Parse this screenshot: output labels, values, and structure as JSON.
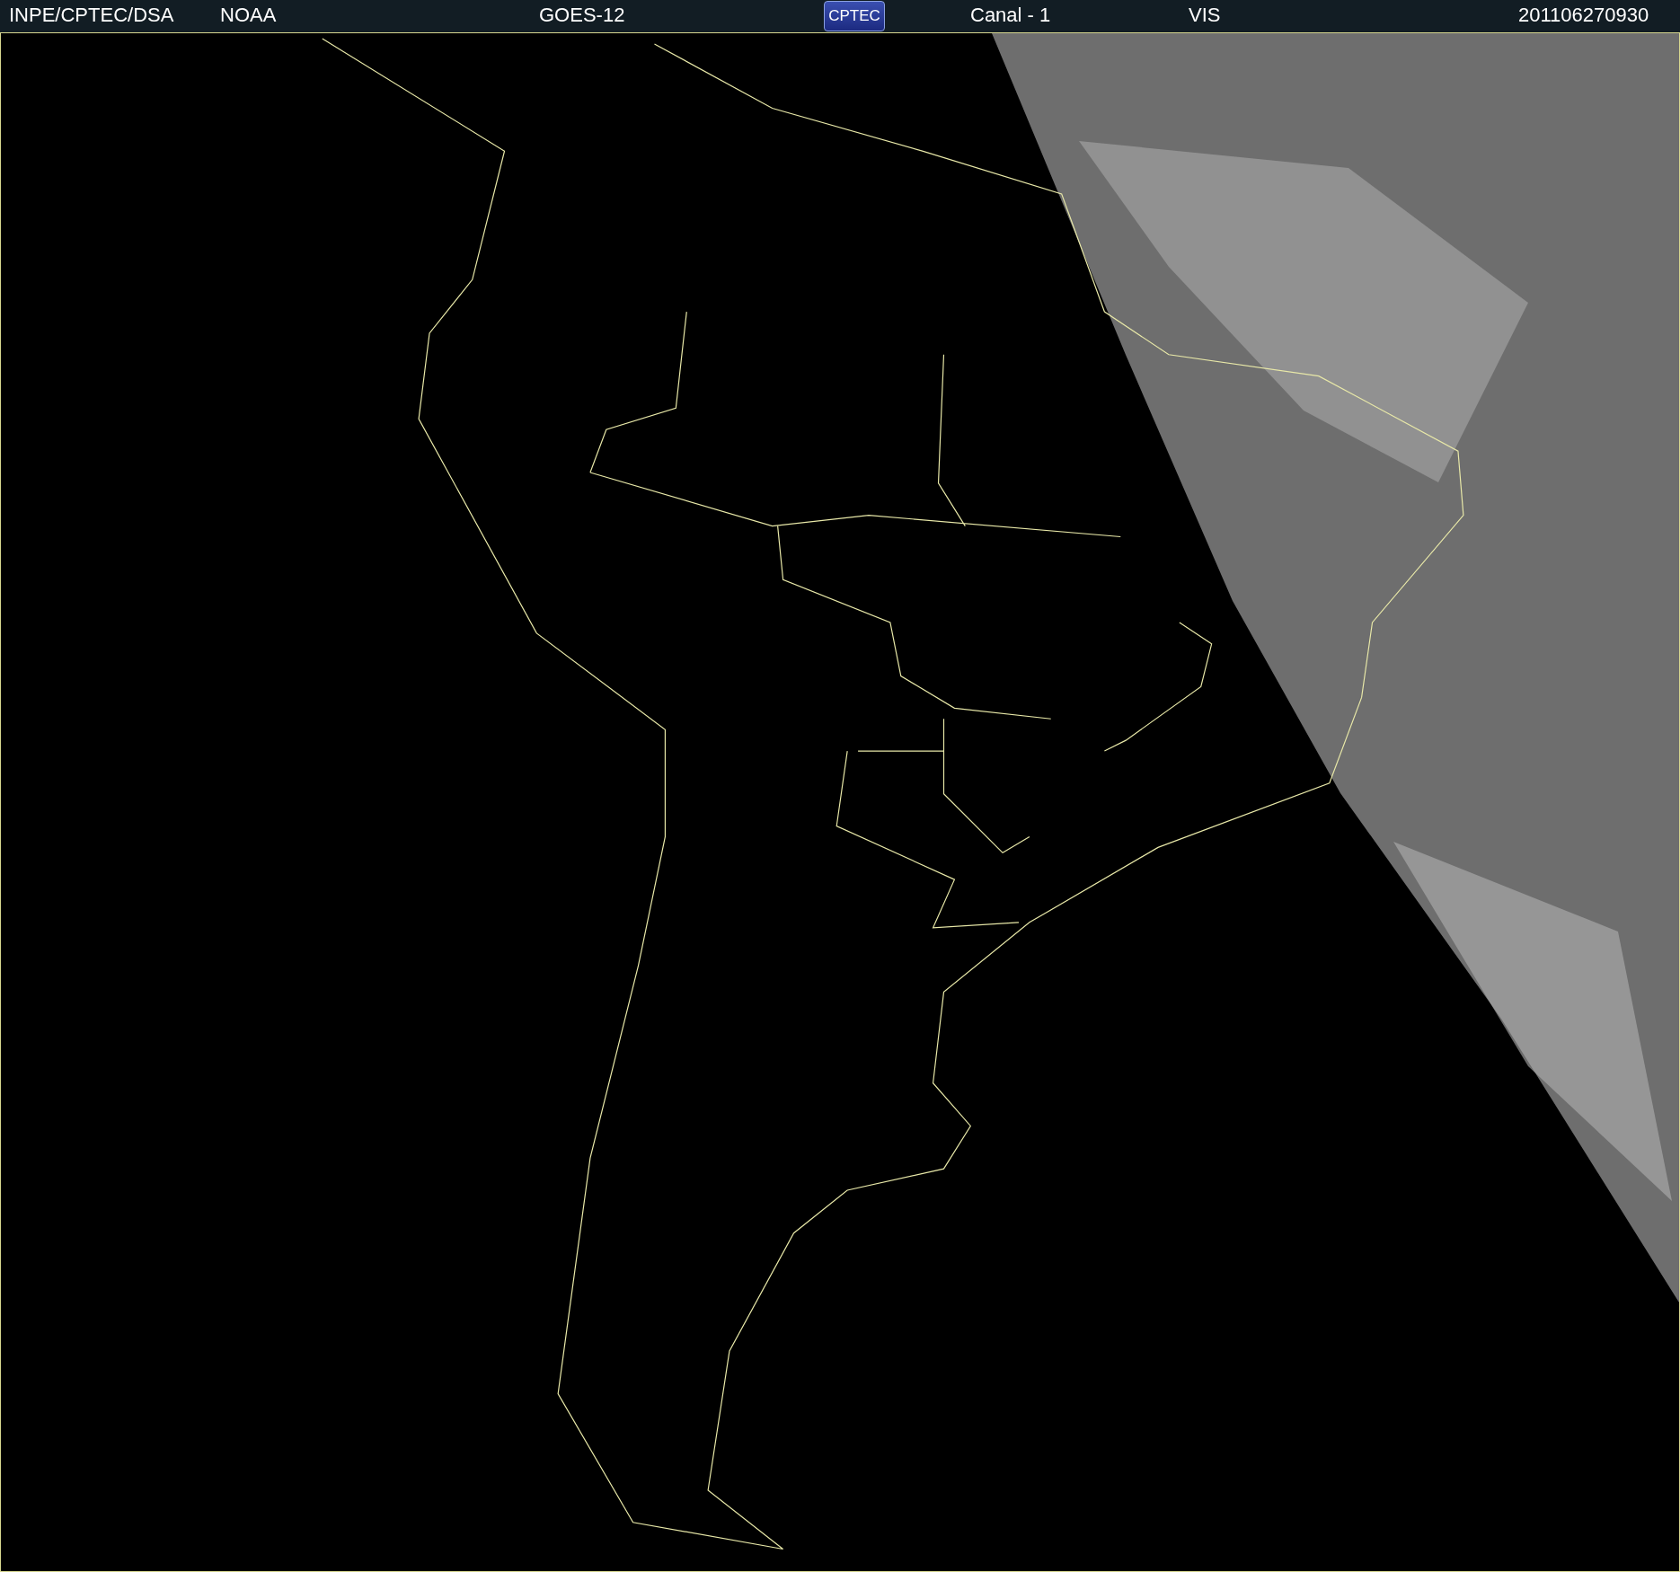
{
  "header": {
    "items": [
      {
        "kind": "text",
        "text": "INPE/CPTEC/DSA"
      },
      {
        "kind": "text",
        "text": "NOAA"
      },
      {
        "kind": "text",
        "text": "GOES-12"
      },
      {
        "kind": "logo",
        "text": "CPTEC"
      },
      {
        "kind": "text",
        "text": "Canal - 1"
      },
      {
        "kind": "text",
        "text": "VIS"
      },
      {
        "kind": "text",
        "text": "201106270930"
      }
    ]
  }
}
